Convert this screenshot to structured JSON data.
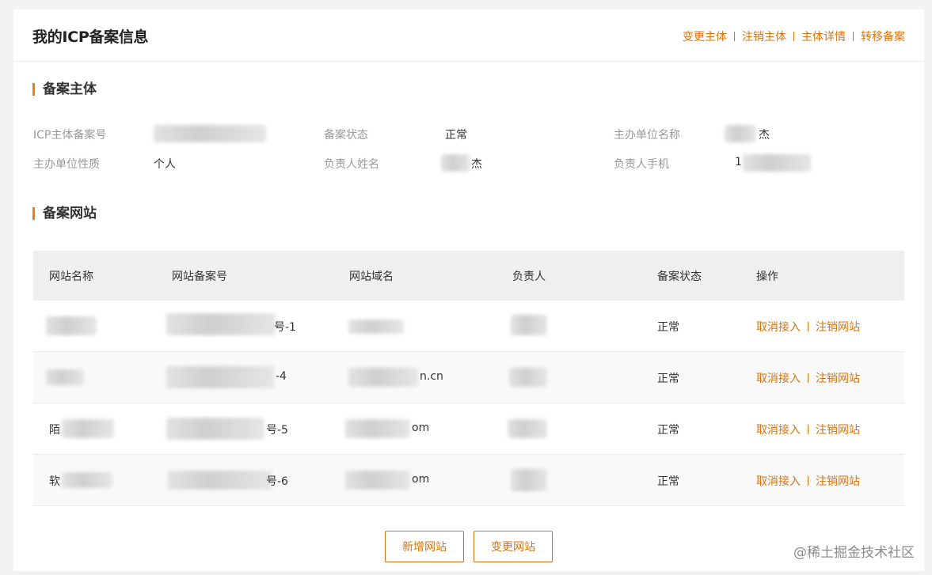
{
  "header": {
    "title": "我的ICP备案信息",
    "actions": [
      "变更主体",
      "注销主体",
      "主体详情",
      "转移备案"
    ]
  },
  "subject": {
    "section_title": "备案主体",
    "fields": [
      {
        "label": "ICP主体备案号",
        "value": ""
      },
      {
        "label": "备案状态",
        "value": "正常"
      },
      {
        "label": "主办单位名称",
        "value": "杰"
      },
      {
        "label": "主办单位性质",
        "value": "个人"
      },
      {
        "label": "负责人姓名",
        "value": "杰"
      },
      {
        "label": "负责人手机",
        "value": "1"
      }
    ]
  },
  "websites": {
    "section_title": "备案网站",
    "columns": [
      "网站名称",
      "网站备案号",
      "网站域名",
      "负责人",
      "备案状态",
      "操作"
    ],
    "rows": [
      {
        "name": "",
        "icp": "号-1",
        "domain": "",
        "owner": "",
        "status": "正常"
      },
      {
        "name": "",
        "icp": "-4",
        "domain": "n.cn",
        "owner": "",
        "status": "正常"
      },
      {
        "name": "陌",
        "icp": "号-5",
        "domain": "om",
        "owner": "",
        "status": "正常"
      },
      {
        "name": "软",
        "icp": "号-6",
        "domain": "om",
        "owner": "",
        "status": "正常"
      }
    ],
    "row_actions": [
      "取消接入",
      "注销网站"
    ]
  },
  "buttons": {
    "add_site": "新增网站",
    "change_site": "变更网站"
  },
  "watermark": "@稀土掘金技术社区",
  "colors": {
    "accent": "#d9730d",
    "section_marker": "#ef7d17",
    "header_bg": "#efefef"
  }
}
